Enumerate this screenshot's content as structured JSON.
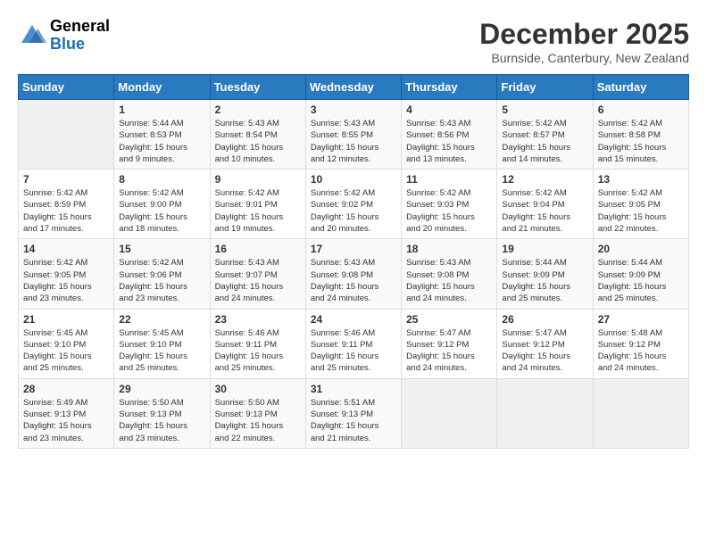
{
  "header": {
    "logo_line1": "General",
    "logo_line2": "Blue",
    "month_title": "December 2025",
    "location": "Burnside, Canterbury, New Zealand"
  },
  "days_of_week": [
    "Sunday",
    "Monday",
    "Tuesday",
    "Wednesday",
    "Thursday",
    "Friday",
    "Saturday"
  ],
  "weeks": [
    [
      {
        "day": "",
        "text": ""
      },
      {
        "day": "1",
        "text": "Sunrise: 5:44 AM\nSunset: 8:53 PM\nDaylight: 15 hours\nand 9 minutes."
      },
      {
        "day": "2",
        "text": "Sunrise: 5:43 AM\nSunset: 8:54 PM\nDaylight: 15 hours\nand 10 minutes."
      },
      {
        "day": "3",
        "text": "Sunrise: 5:43 AM\nSunset: 8:55 PM\nDaylight: 15 hours\nand 12 minutes."
      },
      {
        "day": "4",
        "text": "Sunrise: 5:43 AM\nSunset: 8:56 PM\nDaylight: 15 hours\nand 13 minutes."
      },
      {
        "day": "5",
        "text": "Sunrise: 5:42 AM\nSunset: 8:57 PM\nDaylight: 15 hours\nand 14 minutes."
      },
      {
        "day": "6",
        "text": "Sunrise: 5:42 AM\nSunset: 8:58 PM\nDaylight: 15 hours\nand 15 minutes."
      }
    ],
    [
      {
        "day": "7",
        "text": "Sunrise: 5:42 AM\nSunset: 8:59 PM\nDaylight: 15 hours\nand 17 minutes."
      },
      {
        "day": "8",
        "text": "Sunrise: 5:42 AM\nSunset: 9:00 PM\nDaylight: 15 hours\nand 18 minutes."
      },
      {
        "day": "9",
        "text": "Sunrise: 5:42 AM\nSunset: 9:01 PM\nDaylight: 15 hours\nand 19 minutes."
      },
      {
        "day": "10",
        "text": "Sunrise: 5:42 AM\nSunset: 9:02 PM\nDaylight: 15 hours\nand 20 minutes."
      },
      {
        "day": "11",
        "text": "Sunrise: 5:42 AM\nSunset: 9:03 PM\nDaylight: 15 hours\nand 20 minutes."
      },
      {
        "day": "12",
        "text": "Sunrise: 5:42 AM\nSunset: 9:04 PM\nDaylight: 15 hours\nand 21 minutes."
      },
      {
        "day": "13",
        "text": "Sunrise: 5:42 AM\nSunset: 9:05 PM\nDaylight: 15 hours\nand 22 minutes."
      }
    ],
    [
      {
        "day": "14",
        "text": "Sunrise: 5:42 AM\nSunset: 9:05 PM\nDaylight: 15 hours\nand 23 minutes."
      },
      {
        "day": "15",
        "text": "Sunrise: 5:42 AM\nSunset: 9:06 PM\nDaylight: 15 hours\nand 23 minutes."
      },
      {
        "day": "16",
        "text": "Sunrise: 5:43 AM\nSunset: 9:07 PM\nDaylight: 15 hours\nand 24 minutes."
      },
      {
        "day": "17",
        "text": "Sunrise: 5:43 AM\nSunset: 9:08 PM\nDaylight: 15 hours\nand 24 minutes."
      },
      {
        "day": "18",
        "text": "Sunrise: 5:43 AM\nSunset: 9:08 PM\nDaylight: 15 hours\nand 24 minutes."
      },
      {
        "day": "19",
        "text": "Sunrise: 5:44 AM\nSunset: 9:09 PM\nDaylight: 15 hours\nand 25 minutes."
      },
      {
        "day": "20",
        "text": "Sunrise: 5:44 AM\nSunset: 9:09 PM\nDaylight: 15 hours\nand 25 minutes."
      }
    ],
    [
      {
        "day": "21",
        "text": "Sunrise: 5:45 AM\nSunset: 9:10 PM\nDaylight: 15 hours\nand 25 minutes."
      },
      {
        "day": "22",
        "text": "Sunrise: 5:45 AM\nSunset: 9:10 PM\nDaylight: 15 hours\nand 25 minutes."
      },
      {
        "day": "23",
        "text": "Sunrise: 5:46 AM\nSunset: 9:11 PM\nDaylight: 15 hours\nand 25 minutes."
      },
      {
        "day": "24",
        "text": "Sunrise: 5:46 AM\nSunset: 9:11 PM\nDaylight: 15 hours\nand 25 minutes."
      },
      {
        "day": "25",
        "text": "Sunrise: 5:47 AM\nSunset: 9:12 PM\nDaylight: 15 hours\nand 24 minutes."
      },
      {
        "day": "26",
        "text": "Sunrise: 5:47 AM\nSunset: 9:12 PM\nDaylight: 15 hours\nand 24 minutes."
      },
      {
        "day": "27",
        "text": "Sunrise: 5:48 AM\nSunset: 9:12 PM\nDaylight: 15 hours\nand 24 minutes."
      }
    ],
    [
      {
        "day": "28",
        "text": "Sunrise: 5:49 AM\nSunset: 9:13 PM\nDaylight: 15 hours\nand 23 minutes."
      },
      {
        "day": "29",
        "text": "Sunrise: 5:50 AM\nSunset: 9:13 PM\nDaylight: 15 hours\nand 23 minutes."
      },
      {
        "day": "30",
        "text": "Sunrise: 5:50 AM\nSunset: 9:13 PM\nDaylight: 15 hours\nand 22 minutes."
      },
      {
        "day": "31",
        "text": "Sunrise: 5:51 AM\nSunset: 9:13 PM\nDaylight: 15 hours\nand 21 minutes."
      },
      {
        "day": "",
        "text": ""
      },
      {
        "day": "",
        "text": ""
      },
      {
        "day": "",
        "text": ""
      }
    ]
  ]
}
